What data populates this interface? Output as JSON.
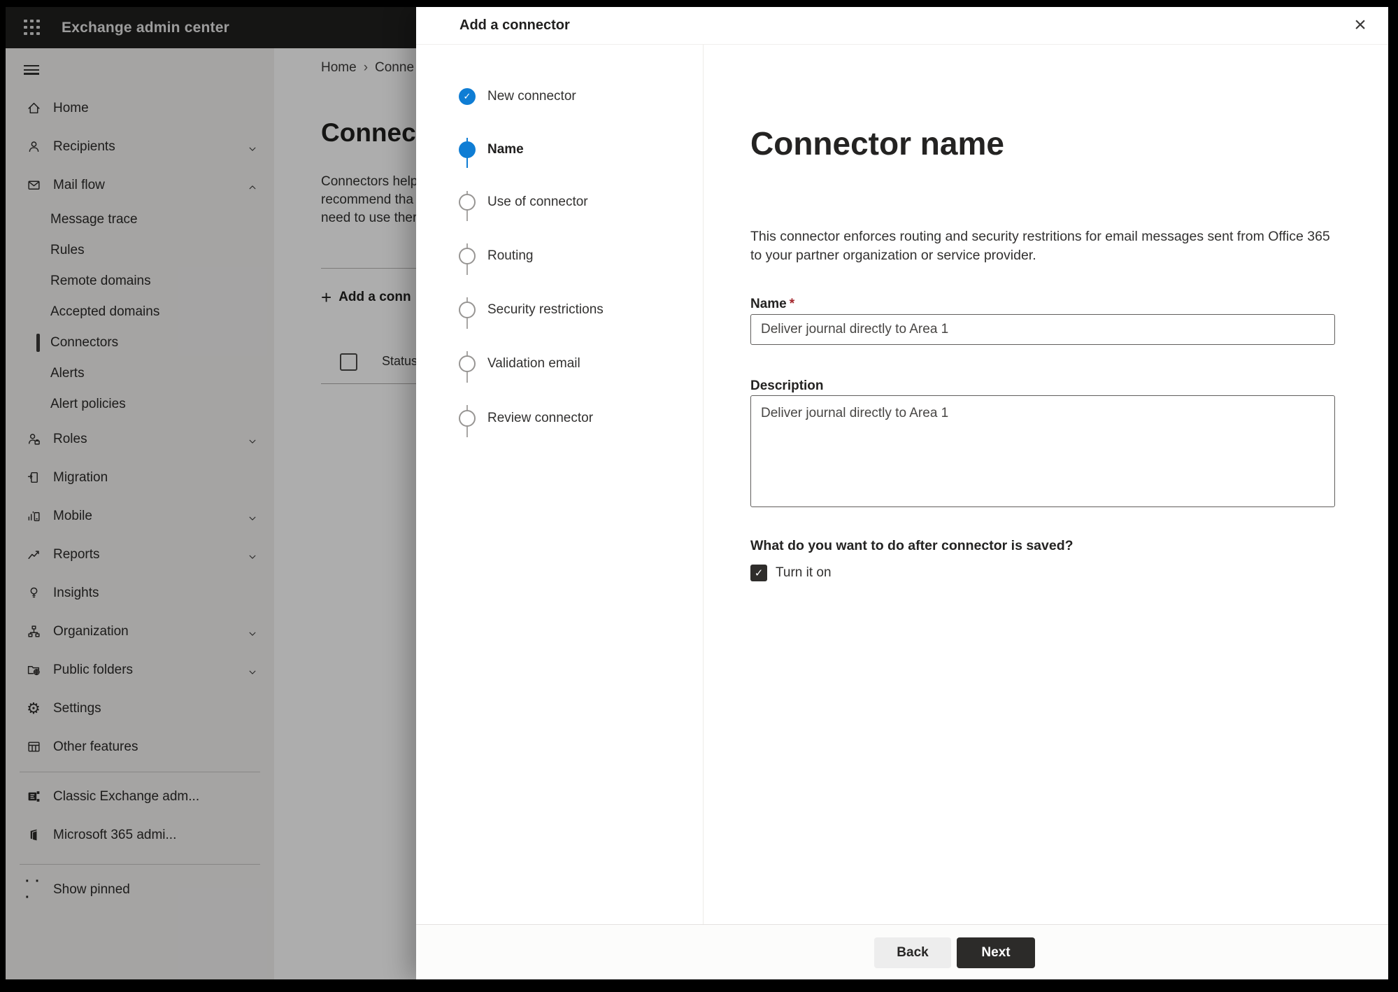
{
  "topbar": {
    "title": "Exchange admin center"
  },
  "sidebar": {
    "items": [
      {
        "label": "Home",
        "icon": "home"
      },
      {
        "label": "Recipients",
        "icon": "person",
        "chevron": "down"
      },
      {
        "label": "Mail flow",
        "icon": "envelope",
        "chevron": "up",
        "expanded": true
      },
      {
        "label": "Roles",
        "icon": "person-badge",
        "chevron": "down"
      },
      {
        "label": "Migration",
        "icon": "migration-document"
      },
      {
        "label": "Mobile",
        "icon": "mobile-chart",
        "chevron": "down"
      },
      {
        "label": "Reports",
        "icon": "line-chart",
        "chevron": "down"
      },
      {
        "label": "Insights",
        "icon": "lightbulb"
      },
      {
        "label": "Organization",
        "icon": "org-chart",
        "chevron": "down"
      },
      {
        "label": "Public folders",
        "icon": "folder-globe",
        "chevron": "down"
      },
      {
        "label": "Settings",
        "icon": "gear",
        "glyph": "⚙"
      },
      {
        "label": "Other features",
        "icon": "table-grid"
      }
    ],
    "mail_flow_items": [
      {
        "label": "Message trace"
      },
      {
        "label": "Rules"
      },
      {
        "label": "Remote domains"
      },
      {
        "label": "Accepted domains"
      },
      {
        "label": "Connectors",
        "selected": true
      },
      {
        "label": "Alerts"
      },
      {
        "label": "Alert policies"
      }
    ],
    "footer_items": [
      {
        "label": "Classic Exchange adm...",
        "icon": "exchange-logo"
      },
      {
        "label": "Microsoft 365 admi...",
        "icon": "m365-logo"
      }
    ],
    "show_pinned": {
      "label": "Show pinned",
      "icon": "ellipsis",
      "glyph": "· · ·"
    }
  },
  "background_page": {
    "breadcrumb": {
      "home": "Home",
      "separator": "›",
      "current": "Conne"
    },
    "heading": "Connec",
    "intro_lines": [
      "Connectors help",
      "recommend tha",
      "need to use ther"
    ],
    "add_button": {
      "plus": "+",
      "label": "Add a conn"
    },
    "table": {
      "status_column": "Status"
    }
  },
  "dialog": {
    "title": "Add a connector",
    "close_glyph": "×",
    "steps": [
      {
        "label": "New connector",
        "state": "completed",
        "check_glyph": "✓"
      },
      {
        "label": "Name",
        "state": "current"
      },
      {
        "label": "Use of connector",
        "state": "upcoming"
      },
      {
        "label": "Routing",
        "state": "upcoming"
      },
      {
        "label": "Security restrictions",
        "state": "upcoming"
      },
      {
        "label": "Validation email",
        "state": "upcoming"
      },
      {
        "label": "Review connector",
        "state": "upcoming"
      }
    ],
    "content": {
      "heading": "Connector name",
      "description_lines": [
        "This connector enforces routing and security restritions for email messages sent from Office 365",
        "to your partner organization or service provider."
      ],
      "name_label": "Name",
      "required_marker": "*",
      "name_value": "Deliver journal directly to Area 1",
      "description_label": "Description",
      "description_value": "Deliver journal directly to Area 1",
      "after_save_question": "What do you want to do after connector is saved?",
      "turn_on_checkbox": {
        "label": "Turn it on",
        "checked": true,
        "check_glyph": "✓"
      }
    },
    "footer": {
      "back_label": "Back",
      "next_label": "Next"
    }
  },
  "colors": {
    "accent_blue": "#0f7dd4",
    "required_red": "#a4262c",
    "next_button_bg": "#2c2b29",
    "topbar_bg": "#201f1e",
    "sidebar_bg": "#f3f2f1",
    "overlay": "rgba(0,0,0,0.32)"
  }
}
